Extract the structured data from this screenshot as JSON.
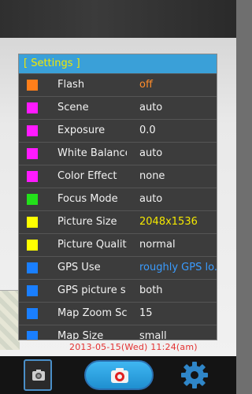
{
  "settings": {
    "title": "[ Settings ]",
    "items": [
      {
        "label": "Flash",
        "value": "off",
        "swatch_color": "#ff7f1a",
        "value_color": "#ff8c2a"
      },
      {
        "label": "Scene",
        "value": "auto",
        "swatch_color": "#ff1aff",
        "value_color": "#f2f2f2"
      },
      {
        "label": "Exposure",
        "value": "0.0",
        "swatch_color": "#ff1aff",
        "value_color": "#f2f2f2"
      },
      {
        "label": "White Balance",
        "value": "auto",
        "swatch_color": "#ff1aff",
        "value_color": "#f2f2f2"
      },
      {
        "label": "Color Effect",
        "value": "none",
        "swatch_color": "#ff1aff",
        "value_color": "#f2f2f2"
      },
      {
        "label": "Focus Mode",
        "value": "auto",
        "swatch_color": "#23e01a",
        "value_color": "#f2f2f2"
      },
      {
        "label": "Picture Size",
        "value": "2048x1536",
        "swatch_color": "#ffff00",
        "value_color": "#f4e800"
      },
      {
        "label": "Picture Quality",
        "value": "normal",
        "swatch_color": "#ffff00",
        "value_color": "#f2f2f2"
      },
      {
        "label": "GPS Use",
        "value": "roughly GPS lo...",
        "swatch_color": "#1a7fff",
        "value_color": "#3a9cff"
      },
      {
        "label": "GPS picture s...",
        "value": "both",
        "swatch_color": "#1a7fff",
        "value_color": "#f2f2f2"
      },
      {
        "label": "Map Zoom Sc...",
        "value": "15",
        "swatch_color": "#1a7fff",
        "value_color": "#f2f2f2"
      },
      {
        "label": "Map Size",
        "value": "small",
        "swatch_color": "#1a7fff",
        "value_color": "#f2f2f2"
      }
    ]
  },
  "preview": {
    "timestamp": "2013-05-15(Wed) 11:24(am)"
  },
  "toolbar": {
    "gallery_icon": "camera-thumbnail-icon",
    "shutter_icon": "camera-icon",
    "settings_icon": "gear-icon"
  },
  "colors": {
    "header_bg": "#3aa0d8",
    "header_text": "#f4e800",
    "timestamp": "#e33131"
  }
}
